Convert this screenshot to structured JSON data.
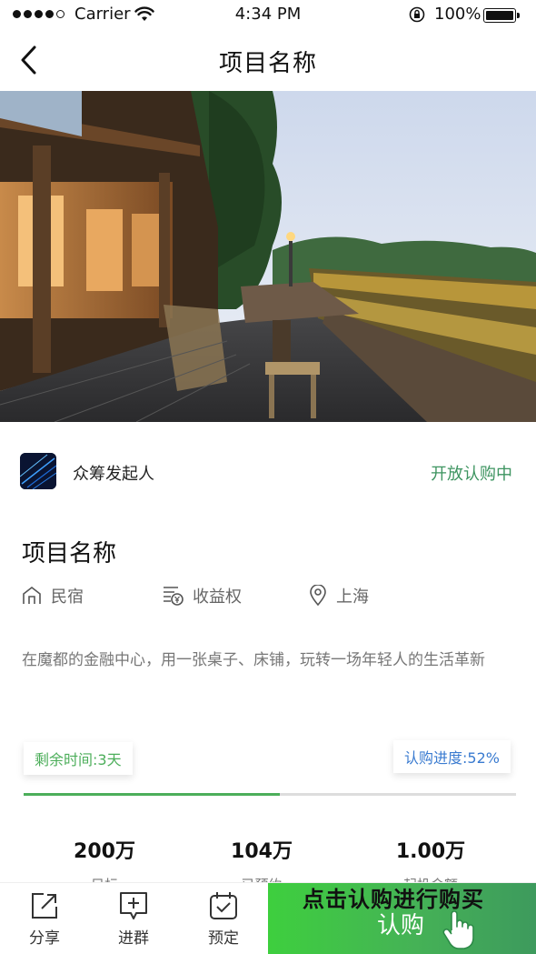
{
  "status_bar": {
    "carrier": "Carrier",
    "time": "4:34 PM",
    "battery": "100%"
  },
  "nav": {
    "title": "项目名称",
    "back_icon": "chevron-left-icon"
  },
  "hero": {
    "image": "terrace-with-wooden-table-at-dusk"
  },
  "initiator": {
    "name": "众筹发起人",
    "status": "开放认购中"
  },
  "project": {
    "title": "项目名称",
    "meta": [
      {
        "icon": "house-icon",
        "label": "民宿"
      },
      {
        "icon": "yen-document-icon",
        "label": "收益权"
      },
      {
        "icon": "location-pin-icon",
        "label": "上海"
      }
    ],
    "description": "在魔都的金融中心，用一张桌子、床铺，玩转一场年轻人的生活革新"
  },
  "progress": {
    "remaining": "剩余时间:3天",
    "subscribed": "认购进度:52%",
    "value": 0.52,
    "colors": {
      "fill": "#4cae5a",
      "track": "#dddddd"
    }
  },
  "stats": [
    {
      "value": "200万",
      "label": "目标"
    },
    {
      "value": "104万",
      "label": "已预约"
    },
    {
      "value": "1.00万",
      "label": "起投金额"
    }
  ],
  "bottom_bar": {
    "tabs": [
      {
        "icon": "share-icon",
        "label": "分享"
      },
      {
        "icon": "chat-plus-icon",
        "label": "进群"
      },
      {
        "icon": "calendar-check-icon",
        "label": "预定"
      }
    ],
    "buy_hint": "点击认购进行购买",
    "buy_label": "认购",
    "buy_color": "#45b256"
  }
}
